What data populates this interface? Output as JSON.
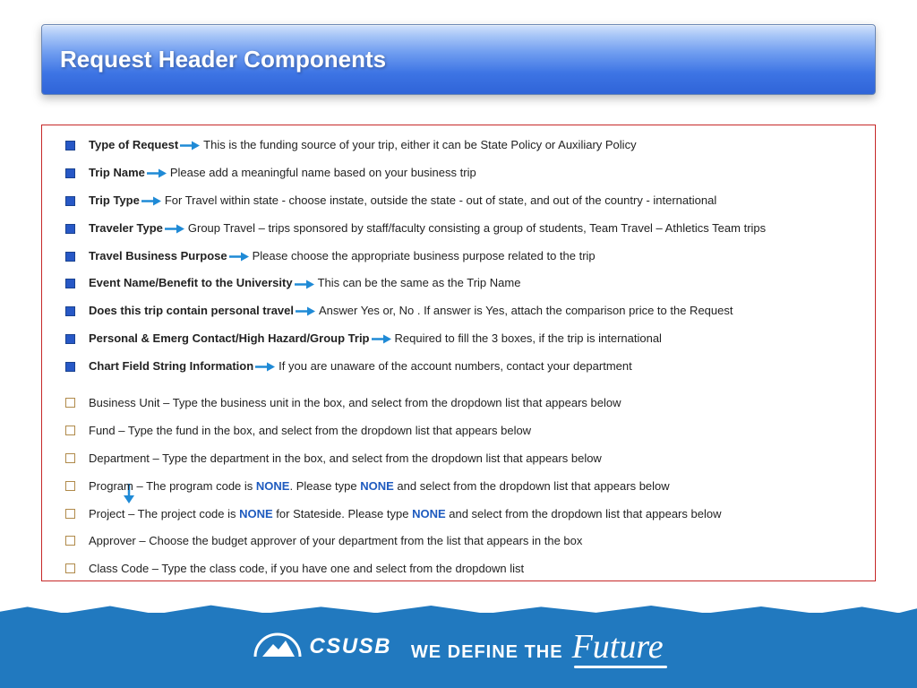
{
  "title": "Request Header Components",
  "primary": [
    {
      "label": "Type of Request",
      "desc": "This is the funding source of your trip, either it can be State Policy or Auxiliary Policy"
    },
    {
      "label": "Trip Name",
      "desc": "Please add a meaningful name based on your business trip"
    },
    {
      "label": "Trip Type",
      "desc": "For Travel within state - choose instate, outside the state - out of state, and out of the country - international"
    },
    {
      "label": "Traveler Type",
      "desc": "Group Travel – trips sponsored by staff/faculty consisting a group of students, Team Travel – Athletics Team trips"
    },
    {
      "label": "Travel Business Purpose",
      "desc": "Please choose the appropriate business purpose related to the trip"
    },
    {
      "label": "Event Name/Benefit to the University",
      "desc": "This can be the same as the Trip Name"
    },
    {
      "label": "Does this trip contain personal travel",
      "desc": "Answer Yes or, No . If answer is Yes, attach the comparison price to the Request"
    },
    {
      "label": "Personal & Emerg Contact/High Hazard/Group Trip",
      "desc": "Required to fill the 3 boxes, if the trip is international"
    },
    {
      "label": "Chart Field String Information",
      "desc": "If you are unaware of the account numbers, contact your department"
    }
  ],
  "secondary": [
    {
      "text": "Business Unit – Type the business unit  in the box, and select from the dropdown list that appears below"
    },
    {
      "text": "Fund – Type the fund  in the box, and select from the dropdown list that appears below"
    },
    {
      "text": "Department – Type the department  in the box, and select from the dropdown list that appears below"
    },
    {
      "parts": [
        "Program – The program code is ",
        "NONE",
        ". Please type ",
        "NONE",
        " and select from the dropdown list that appears below"
      ]
    },
    {
      "parts": [
        "Project – The project code is ",
        "NONE",
        " for Stateside. Please type ",
        "NONE",
        " and select from the dropdown list that appears below"
      ]
    },
    {
      "text": "Approver – Choose the budget approver of your department from the list that appears in the box"
    },
    {
      "text": "Class Code – Type the class code, if you have one and select from the dropdown list"
    }
  ],
  "footer": {
    "brand": "CSUSB",
    "tagline_a": "WE DEFINE THE",
    "tagline_b": "Future"
  }
}
